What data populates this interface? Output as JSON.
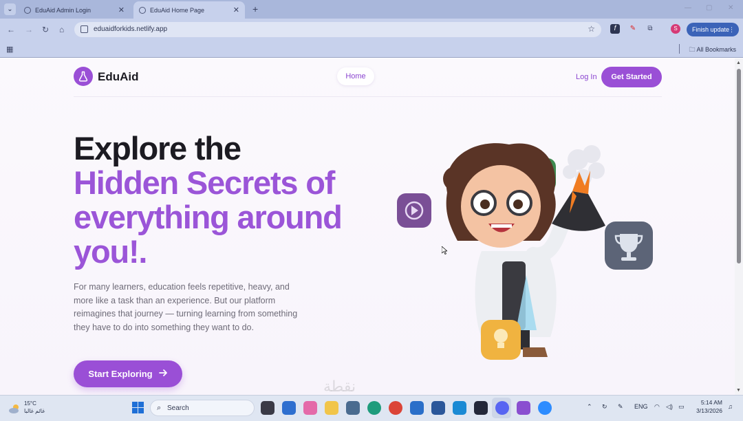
{
  "browser": {
    "tabs": [
      {
        "title": "EduAid Admin Login",
        "active": false
      },
      {
        "title": "EduAid Home Page",
        "active": true
      }
    ],
    "url": "eduaidforkids.netlify.app",
    "update_label": "Finish update",
    "profile_initial": "S",
    "bookmarks_label": "All Bookmarks"
  },
  "site": {
    "brand": "EduAid",
    "nav": {
      "home": "Home",
      "login": "Log In",
      "get_started": "Get Started"
    },
    "hero": {
      "line1": "Explore the",
      "line2": "Hidden Secrets of",
      "line3": "everything around",
      "line4": "you!.",
      "description": "For many learners, education feels repetitive, heavy, and more like a task than an experience. But our platform reimagines that journey — turning learning from something they have to do into something they want to do.",
      "cta": "Start Exploring"
    },
    "colors": {
      "accent": "#9a4fd6",
      "heading": "#1c1b22",
      "text": "#6e6b78"
    },
    "floating_icons": [
      "play-icon",
      "trophy-icon",
      "lightbulb-icon",
      "book-icon"
    ]
  },
  "taskbar": {
    "weather_temp": "15°C",
    "weather_desc": "غائم غالبا",
    "search_label": "Search",
    "lang": "ENG",
    "time": "5:14 AM",
    "date": "3/13/2026"
  },
  "watermark": "نقطة"
}
